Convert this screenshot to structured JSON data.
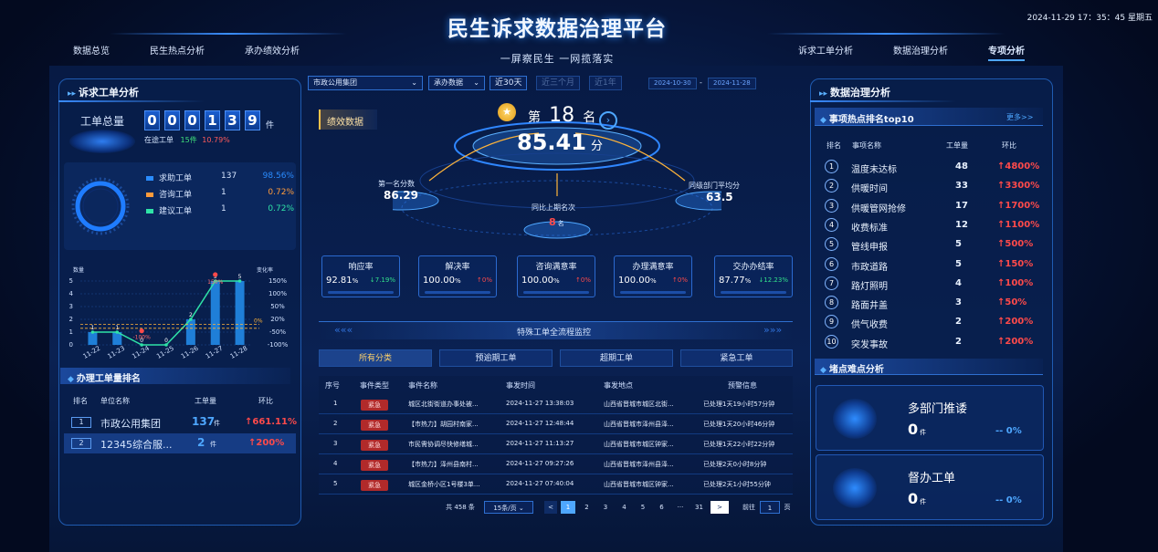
{
  "header": {
    "title": "民生诉求数据治理平台",
    "subtitle": "一屏察民生 一网揽落实",
    "datetime": "2024-11-29  17：35：45 星期五",
    "nav_left": [
      "数据总览",
      "民生热点分析",
      "承办绩效分析"
    ],
    "nav_right": [
      "诉求工单分析",
      "数据治理分析",
      "专项分析"
    ]
  },
  "left": {
    "title": "诉求工单分析",
    "total_label": "工单总量",
    "digits": [
      "0",
      "0",
      "0",
      "1",
      "3",
      "9"
    ],
    "unit": "件",
    "pending_label": "在途工单",
    "pending_count": "15件",
    "pending_pct": "10.79%",
    "legend": [
      {
        "name": "求助工单",
        "count": "137",
        "pct": "98.56%",
        "color": "#2a8cff"
      },
      {
        "name": "咨询工单",
        "count": "1",
        "pct": "0.72%",
        "color": "#ff9b3b"
      },
      {
        "name": "建议工单",
        "count": "1",
        "pct": "0.72%",
        "color": "#2fe3a7"
      }
    ],
    "rank_title": "办理工单量排名",
    "rank_headers": [
      "排名",
      "单位名称",
      "工单量",
      "环比"
    ],
    "ranks": [
      {
        "no": "1",
        "name": "市政公用集团",
        "count": "137",
        "unit": "件",
        "chg": "↑661.11%"
      },
      {
        "no": "2",
        "name": "12345综合服...",
        "count": "2",
        "unit": "件",
        "chg": "↑200%"
      }
    ]
  },
  "chart_data": {
    "type": "bar",
    "categories": [
      "11-22",
      "11-23",
      "11-24",
      "11-25",
      "11-26",
      "11-27",
      "11-28"
    ],
    "values": [
      1,
      1,
      0,
      0,
      2,
      5,
      5
    ],
    "ylim": [
      0,
      5
    ],
    "ylabel": "数量",
    "y2label": "变化率",
    "series": [
      {
        "name": "数量",
        "values": [
          1,
          1,
          0,
          0,
          2,
          5,
          5
        ]
      },
      {
        "name": "变化率",
        "values": [
          0,
          0,
          -100,
          0,
          0,
          150,
          0
        ]
      }
    ],
    "y2_ticks": [
      "150%",
      "100%",
      "50%",
      "20%",
      "-50%",
      "-100%"
    ],
    "point_labels": [
      "1",
      "1",
      "0",
      "0",
      "2",
      "5",
      "5"
    ],
    "annotations": [
      "-100%",
      "150%",
      "0%"
    ]
  },
  "center": {
    "select_dept": "市政公用集团",
    "select_type": "承办数据",
    "btn_30": "近30天",
    "btn_3m": "近三个月",
    "btn_1y": "近1年",
    "date_from": "2024-10-30",
    "date_sep": "-",
    "date_to": "2024-11-28",
    "badge": "绩效数据",
    "rank_prefix": "第",
    "rank_value": "18",
    "rank_suffix": "名",
    "score": "85.41",
    "score_unit": "分",
    "first_label": "第一名分数",
    "first_value": "86.29",
    "avg_label": "同级部门平均分",
    "avg_value": "63.5",
    "prev_label": "同比上期名次",
    "prev_value": "8",
    "prev_unit": "名",
    "metrics": [
      {
        "label": "响应率",
        "value": "92.81",
        "change": "↓7.19%",
        "dir": "down"
      },
      {
        "label": "解决率",
        "value": "100.00",
        "change": "↑0%",
        "dir": "up"
      },
      {
        "label": "咨询满意率",
        "value": "100.00",
        "change": "↑0%",
        "dir": "up"
      },
      {
        "label": "办理满意率",
        "value": "100.00",
        "change": "↑0%",
        "dir": "up"
      },
      {
        "label": "交办办结率",
        "value": "87.77",
        "change": "↓12.23%",
        "dir": "down"
      }
    ],
    "monitor_label": "特殊工单全流程监控",
    "tabs": [
      "所有分类",
      "预逾期工单",
      "超期工单",
      "紧急工单"
    ],
    "table_headers": [
      "序号",
      "事件类型",
      "事件名称",
      "事发时间",
      "事发地点",
      "预警信息"
    ],
    "rows": [
      {
        "no": "1",
        "type": "紧急",
        "name": "城区北街街道办事处被...",
        "time": "2024-11-27 13:38:03",
        "place": "山西省晋城市城区北街...",
        "warn": "已处理1天19小时57分钟"
      },
      {
        "no": "2",
        "type": "紧急",
        "name": "【市热力】胡园村南家...",
        "time": "2024-11-27 12:48:44",
        "place": "山西省晋城市泽州县泽...",
        "warn": "已处理1天20小时46分钟"
      },
      {
        "no": "3",
        "type": "紧急",
        "name": "市民需协调尽快修缮城...",
        "time": "2024-11-27 11:13:27",
        "place": "山西省晋城市城区钟家...",
        "warn": "已处理1天22小时22分钟"
      },
      {
        "no": "4",
        "type": "紧急",
        "name": "【市热力】泽州县南村...",
        "time": "2024-11-27 09:27:26",
        "place": "山西省晋城市泽州县泽...",
        "warn": "已处理2天0小时8分钟"
      },
      {
        "no": "5",
        "type": "紧急",
        "name": "城区金桥小区1号楼3单...",
        "time": "2024-11-27 07:40:04",
        "place": "山西省晋城市城区钟家...",
        "warn": "已处理2天1小时55分钟"
      }
    ],
    "pager": {
      "total": "共 458 条",
      "size": "15条/页",
      "pages": [
        "1",
        "2",
        "3",
        "4",
        "5",
        "6",
        "···",
        "31"
      ],
      "goto": "前往",
      "page": "1",
      "page_unit": "页",
      "prev": "<",
      "next": ">"
    }
  },
  "right": {
    "title": "数据治理分析",
    "hot_title": "事项热点排名top10",
    "more": "更多>>",
    "headers": [
      "排名",
      "事项名称",
      "工单量",
      "环比"
    ],
    "items": [
      {
        "no": "1",
        "name": "温度未达标",
        "count": "48",
        "chg": "↑4800%"
      },
      {
        "no": "2",
        "name": "供暖时间",
        "count": "33",
        "chg": "↑3300%"
      },
      {
        "no": "3",
        "name": "供暖管网抢修",
        "count": "17",
        "chg": "↑1700%"
      },
      {
        "no": "4",
        "name": "收费标准",
        "count": "12",
        "chg": "↑1100%"
      },
      {
        "no": "5",
        "name": "管线申报",
        "count": "5",
        "chg": "↑500%"
      },
      {
        "no": "6",
        "name": "市政道路",
        "count": "5",
        "chg": "↑150%"
      },
      {
        "no": "7",
        "name": "路灯照明",
        "count": "4",
        "chg": "↑100%"
      },
      {
        "no": "8",
        "name": "路面井盖",
        "count": "3",
        "chg": "↑50%"
      },
      {
        "no": "9",
        "name": "供气收费",
        "count": "2",
        "chg": "↑200%"
      },
      {
        "no": "10",
        "name": "突发事故",
        "count": "2",
        "chg": "↑200%"
      }
    ],
    "block_title": "堵点难点分析",
    "cards": [
      {
        "label": "多部门推诿",
        "value": "0",
        "unit": "件",
        "chg": "-- 0%"
      },
      {
        "label": "督办工单",
        "value": "0",
        "unit": "件",
        "chg": "-- 0%"
      }
    ]
  }
}
